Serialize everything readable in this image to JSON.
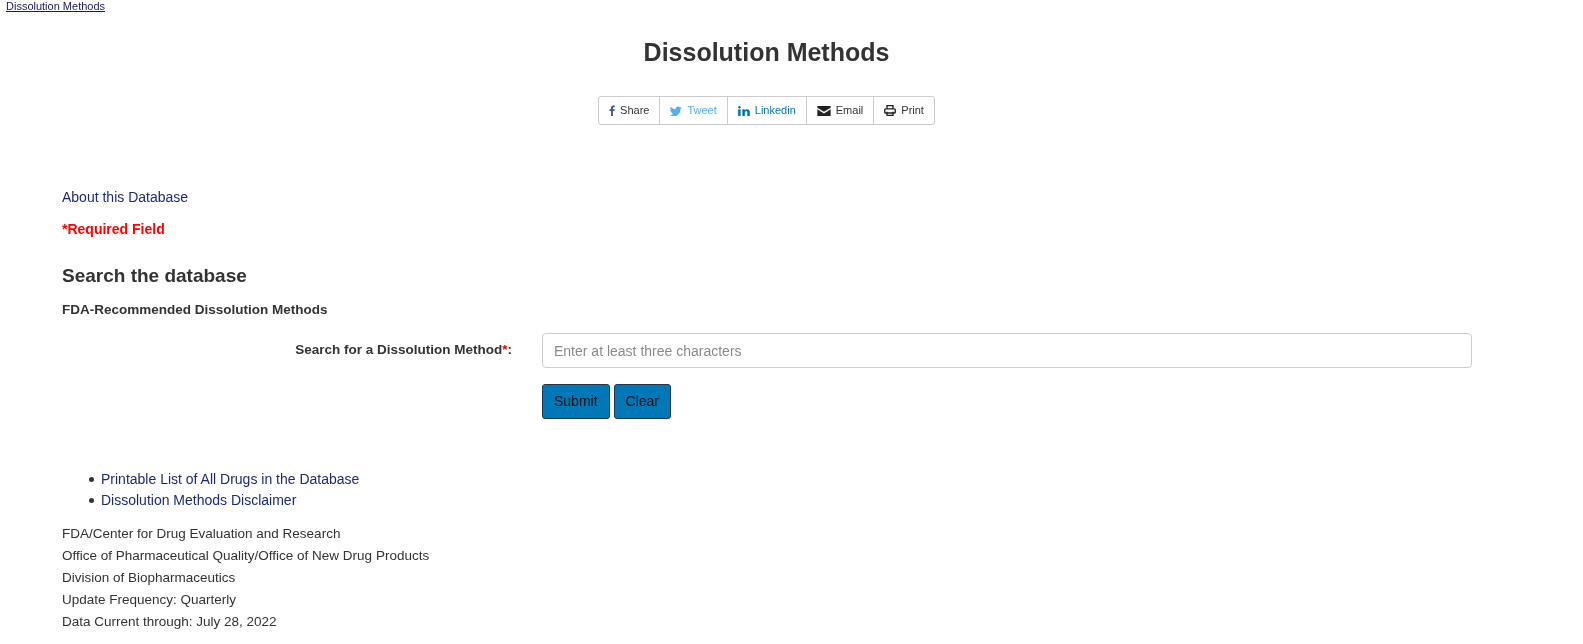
{
  "breadcrumb": {
    "label": "Dissolution Methods"
  },
  "title": "Dissolution Methods",
  "share_buttons": [
    {
      "kind": "facebook",
      "label": "Share"
    },
    {
      "kind": "twitter",
      "label": "Tweet"
    },
    {
      "kind": "linkedin",
      "label": "Linkedin"
    },
    {
      "kind": "email",
      "label": "Email"
    },
    {
      "kind": "print",
      "label": "Print"
    }
  ],
  "about_link": "About this Database",
  "required_note": "*Required Field",
  "section_heading": "Search the database",
  "subheading": "FDA-Recommended Dissolution Methods",
  "search": {
    "label": "Search for a Dissolution Method",
    "required_mark": "*",
    "suffix": ":",
    "placeholder": "Enter at least three characters"
  },
  "buttons": [
    "Submit",
    "Clear"
  ],
  "links": [
    "Printable List of All Drugs in the Database",
    "Dissolution Methods Disclaimer"
  ],
  "contact_lines": [
    "FDA/Center for Drug Evaluation and Research",
    "Office of Pharmaceutical Quality/Office of New Drug Products",
    "Division of Biopharmaceutics",
    "Update Frequency: Quarterly",
    "Data Current through: July 28, 2022"
  ]
}
